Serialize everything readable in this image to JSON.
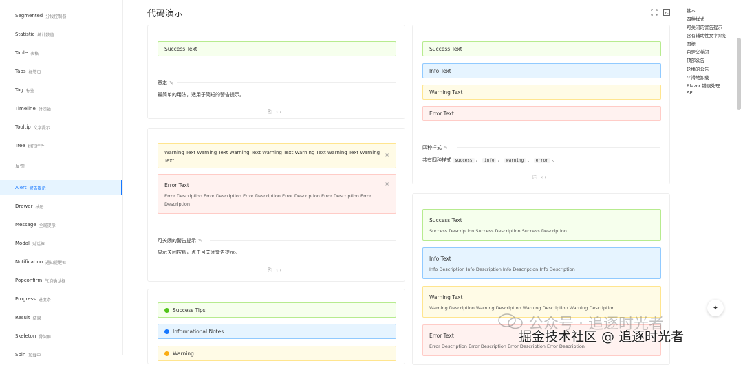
{
  "sidebar": {
    "items": [
      {
        "label": "Segmented",
        "zh": "分段控制器",
        "active": false
      },
      {
        "label": "Statistic",
        "zh": "统计数值",
        "active": false
      },
      {
        "label": "Table",
        "zh": "表格",
        "active": false
      },
      {
        "label": "Tabs",
        "zh": "标签页",
        "active": false
      },
      {
        "label": "Tag",
        "zh": "标签",
        "active": false
      },
      {
        "label": "Timeline",
        "zh": "时间轴",
        "active": false
      },
      {
        "label": "Tooltip",
        "zh": "文字提示",
        "active": false
      },
      {
        "label": "Tree",
        "zh": "树形控件",
        "active": false
      },
      {
        "label": "Alert",
        "zh": "警告提示",
        "active": true
      },
      {
        "label": "Drawer",
        "zh": "抽屉",
        "active": false
      },
      {
        "label": "Message",
        "zh": "全局提示",
        "active": false
      },
      {
        "label": "Modal",
        "zh": "对话框",
        "active": false
      },
      {
        "label": "Notification",
        "zh": "通知提醒框",
        "active": false
      },
      {
        "label": "Popconfirm",
        "zh": "气泡确认框",
        "active": false
      },
      {
        "label": "Progress",
        "zh": "进度条",
        "active": false
      },
      {
        "label": "Result",
        "zh": "结果",
        "active": false
      },
      {
        "label": "Skeleton",
        "zh": "骨架屏",
        "active": false
      },
      {
        "label": "Spin",
        "zh": "加载中",
        "active": false
      }
    ],
    "group_label": "反馈"
  },
  "header": {
    "title": "代码演示",
    "fullscreen_icon": "fullscreen-icon",
    "code_icon": "code-icon"
  },
  "left_col": {
    "card1": {
      "alert": "Success Text",
      "section_title": "基本",
      "section_desc": "最简单的用法，适用于简短的警告提示。"
    },
    "card2": {
      "warning_alert": "Warning Text Warning Text Warning Text Warning Text Warning Text Warning Text Warning Text",
      "error_alert_title": "Error Text",
      "error_alert_desc": "Error Description Error Description Error Description Error Description Error Description Error Description",
      "section_title": "可关闭的警告提示",
      "section_desc": "显示关闭按钮，点击可关闭警告提示。"
    },
    "card3": {
      "items": [
        {
          "label": "Success Tips",
          "type": "success",
          "icon": "check-circle-icon"
        },
        {
          "label": "Informational Notes",
          "type": "info",
          "icon": "info-circle-icon"
        },
        {
          "label": "Warning",
          "type": "warning",
          "icon": "exclamation-circle-icon"
        }
      ]
    }
  },
  "right_col": {
    "card1": {
      "alerts": [
        {
          "label": "Success Text",
          "type": "success"
        },
        {
          "label": "Info Text",
          "type": "info"
        },
        {
          "label": "Warning Text",
          "type": "warning"
        },
        {
          "label": "Error Text",
          "type": "error"
        }
      ],
      "section_title": "四种样式",
      "section_desc_prefix": "共有四种样式",
      "codes": [
        "success",
        "info",
        "warning",
        "error"
      ],
      "sep": "、",
      "end": "。"
    },
    "card2": {
      "alerts": [
        {
          "title": "Success Text",
          "desc": "Success Description Success Description Success Description",
          "type": "success"
        },
        {
          "title": "Info Text",
          "desc": "Info Description Info Description Info Description Info Description",
          "type": "info"
        },
        {
          "title": "Warning Text",
          "desc": "Warning Description Warning Description Warning Description Warning Description",
          "type": "warning"
        },
        {
          "title": "Error Text",
          "desc": "Error Description Error Description Error Description Error Description",
          "type": "error"
        }
      ]
    }
  },
  "toc": {
    "items": [
      "基本",
      "四种样式",
      "可关闭的警告提示",
      "含有辅助性文字介绍",
      "图标",
      "自定义关闭",
      "顶部公告",
      "轮播的公告",
      "平滑地卸载",
      "Blazor 错误处理",
      "API"
    ]
  },
  "watermark": {
    "line1": "公众号 · 追逐时光者",
    "line2": "掘金技术社区 @ 追逐时光者"
  },
  "colors": {
    "accent": "#1677ff",
    "success_bg": "#f6ffed",
    "info_bg": "#e6f4ff",
    "warning_bg": "#fffbe6",
    "error_bg": "#fff2f0"
  }
}
